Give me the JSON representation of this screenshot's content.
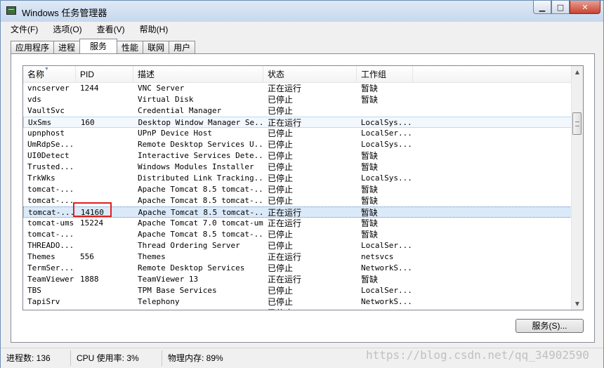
{
  "window": {
    "title": "Windows 任务管理器",
    "controls": {
      "minimize": "▁",
      "maximize": "□",
      "close": "✕"
    }
  },
  "menu": [
    {
      "label": "文件(F)"
    },
    {
      "label": "选项(O)"
    },
    {
      "label": "查看(V)"
    },
    {
      "label": "帮助(H)"
    }
  ],
  "tabs": [
    {
      "label": "应用程序",
      "active": false
    },
    {
      "label": "进程",
      "active": false
    },
    {
      "label": "服务",
      "active": true
    },
    {
      "label": "性能",
      "active": false
    },
    {
      "label": "联网",
      "active": false
    },
    {
      "label": "用户",
      "active": false
    }
  ],
  "table": {
    "columns": [
      "名称",
      "PID",
      "描述",
      "状态",
      "工作组"
    ],
    "rows": [
      {
        "name": "vncserver",
        "pid": "1244",
        "desc": "VNC Server",
        "status": "正在运行",
        "group": "暂缺"
      },
      {
        "name": "vds",
        "pid": "",
        "desc": "Virtual Disk",
        "status": "已停止",
        "group": "暂缺"
      },
      {
        "name": "VaultSvc",
        "pid": "",
        "desc": "Credential Manager",
        "status": "已停止",
        "group": ""
      },
      {
        "name": "UxSms",
        "pid": "160",
        "desc": "Desktop Window Manager Se...",
        "status": "正在运行",
        "group": "LocalSys...",
        "state": "hover"
      },
      {
        "name": "upnphost",
        "pid": "",
        "desc": "UPnP Device Host",
        "status": "已停止",
        "group": "LocalSer..."
      },
      {
        "name": "UmRdpSe...",
        "pid": "",
        "desc": "Remote Desktop Services U...",
        "status": "已停止",
        "group": "LocalSys..."
      },
      {
        "name": "UI0Detect",
        "pid": "",
        "desc": "Interactive Services Dete...",
        "status": "已停止",
        "group": "暂缺"
      },
      {
        "name": "Trusted...",
        "pid": "",
        "desc": "Windows Modules Installer",
        "status": "已停止",
        "group": "暂缺"
      },
      {
        "name": "TrkWks",
        "pid": "",
        "desc": "Distributed Link Tracking...",
        "status": "已停止",
        "group": "LocalSys..."
      },
      {
        "name": "tomcat-...",
        "pid": "",
        "desc": "Apache Tomcat 8.5 tomcat-...",
        "status": "已停止",
        "group": "暂缺"
      },
      {
        "name": "tomcat-...",
        "pid": "",
        "desc": "Apache Tomcat 8.5 tomcat-...",
        "status": "已停止",
        "group": "暂缺"
      },
      {
        "name": "tomcat-...",
        "pid": "14160",
        "desc": "Apache Tomcat 8.5 tomcat-...",
        "status": "正在运行",
        "group": "暂缺",
        "state": "selected"
      },
      {
        "name": "tomcat-ums",
        "pid": "15224",
        "desc": "Apache Tomcat 7.0 tomcat-ums",
        "status": "正在运行",
        "group": "暂缺"
      },
      {
        "name": "tomcat-...",
        "pid": "",
        "desc": "Apache Tomcat 8.5 tomcat-...",
        "status": "已停止",
        "group": "暂缺"
      },
      {
        "name": "THREADO...",
        "pid": "",
        "desc": "Thread Ordering Server",
        "status": "已停止",
        "group": "LocalSer..."
      },
      {
        "name": "Themes",
        "pid": "556",
        "desc": "Themes",
        "status": "正在运行",
        "group": "netsvcs"
      },
      {
        "name": "TermSer...",
        "pid": "",
        "desc": "Remote Desktop Services",
        "status": "已停止",
        "group": "NetworkS..."
      },
      {
        "name": "TeamViewer",
        "pid": "1888",
        "desc": "TeamViewer 13",
        "status": "正在运行",
        "group": "暂缺"
      },
      {
        "name": "TBS",
        "pid": "",
        "desc": "TPM Base Services",
        "status": "已停止",
        "group": "LocalSer..."
      },
      {
        "name": "TapiSrv",
        "pid": "",
        "desc": "Telephony",
        "status": "已停止",
        "group": "NetworkS..."
      },
      {
        "name": "TabletI...",
        "pid": "",
        "desc": "Tablet PC Input Service",
        "status": "已停止",
        "group": "LocalSys..."
      }
    ]
  },
  "services_button": "服务(S)...",
  "status": {
    "processes": "进程数: 136",
    "cpu": "CPU 使用率: 3%",
    "memory": "物理内存: 89%"
  },
  "watermark": "https://blog.csdn.net/qq_34902590",
  "icons": {
    "sort": "sort-indicator-icon",
    "scroll_up": "scroll-up-icon",
    "scroll_down": "scroll-down-icon"
  }
}
